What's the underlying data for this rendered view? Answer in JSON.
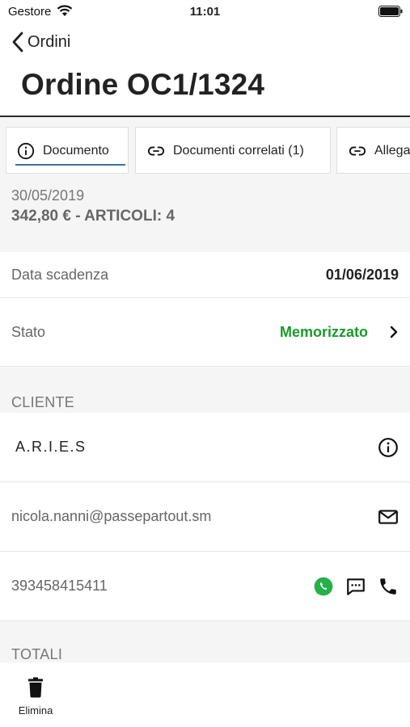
{
  "status_bar": {
    "carrier": "Gestore",
    "time": "11:01"
  },
  "nav": {
    "back_label": "Ordini",
    "title": "Ordine OC1/1324"
  },
  "tabs": [
    {
      "label": "Documento",
      "icon": "info-icon",
      "active": true
    },
    {
      "label": "Documenti correlati (1)",
      "icon": "link-icon"
    },
    {
      "label": "Allegati",
      "icon": "link-icon"
    }
  ],
  "summary": {
    "date": "30/05/2019",
    "total": "342,80 € - ARTICOLI: 4"
  },
  "details": {
    "due_label": "Data scadenza",
    "due_value": "01/06/2019",
    "status_label": "Stato",
    "status_value": "Memorizzato",
    "status_color": "#1a9a2e"
  },
  "client": {
    "header": "CLIENTE",
    "name": "A.R.I.E.S",
    "email": "nicola.nanni@passepartout.sm",
    "phone": "393458415411"
  },
  "totals": {
    "header": "TOTALI"
  },
  "bottom_bar": {
    "delete_label": "Elimina"
  }
}
